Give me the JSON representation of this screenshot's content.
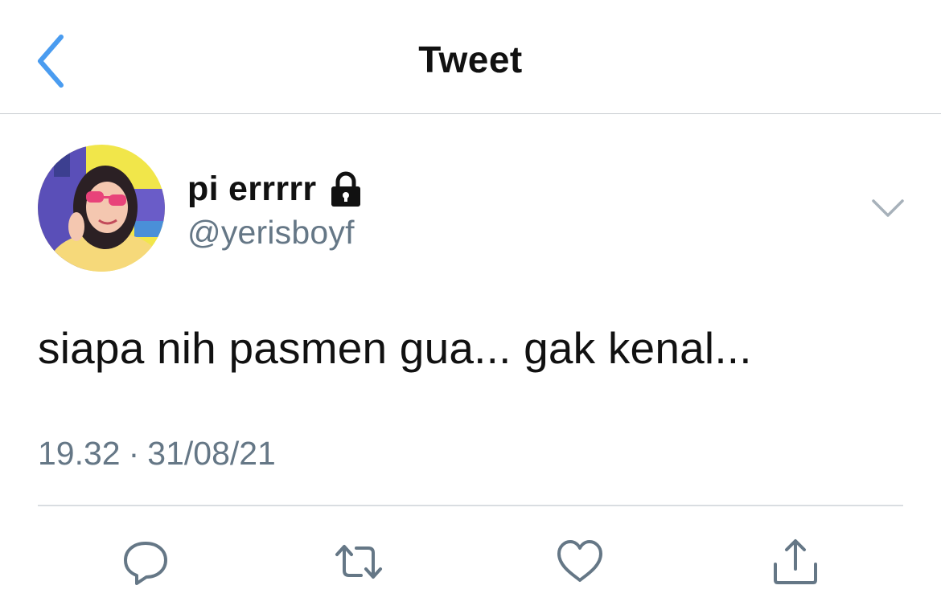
{
  "nav": {
    "title": "Tweet"
  },
  "tweet": {
    "author": {
      "display_name": "pi errrrr",
      "username": "@yerisboyf",
      "protected": true
    },
    "text": "siapa nih pasmen gua... gak kenal...",
    "time": "19.32",
    "separator": "·",
    "date": "31/08/21"
  },
  "icons": {
    "back": "chevron-left-icon",
    "protected": "lock-icon",
    "more": "chevron-down-icon",
    "reply": "reply-bubble-icon",
    "retweet": "retweet-icon",
    "like": "heart-icon",
    "share": "share-icon"
  },
  "colors": {
    "accent": "#4a9cf0",
    "text_primary": "#111111",
    "text_secondary": "#657786",
    "divider": "#d9dde1",
    "icon_gray": "#657786"
  }
}
